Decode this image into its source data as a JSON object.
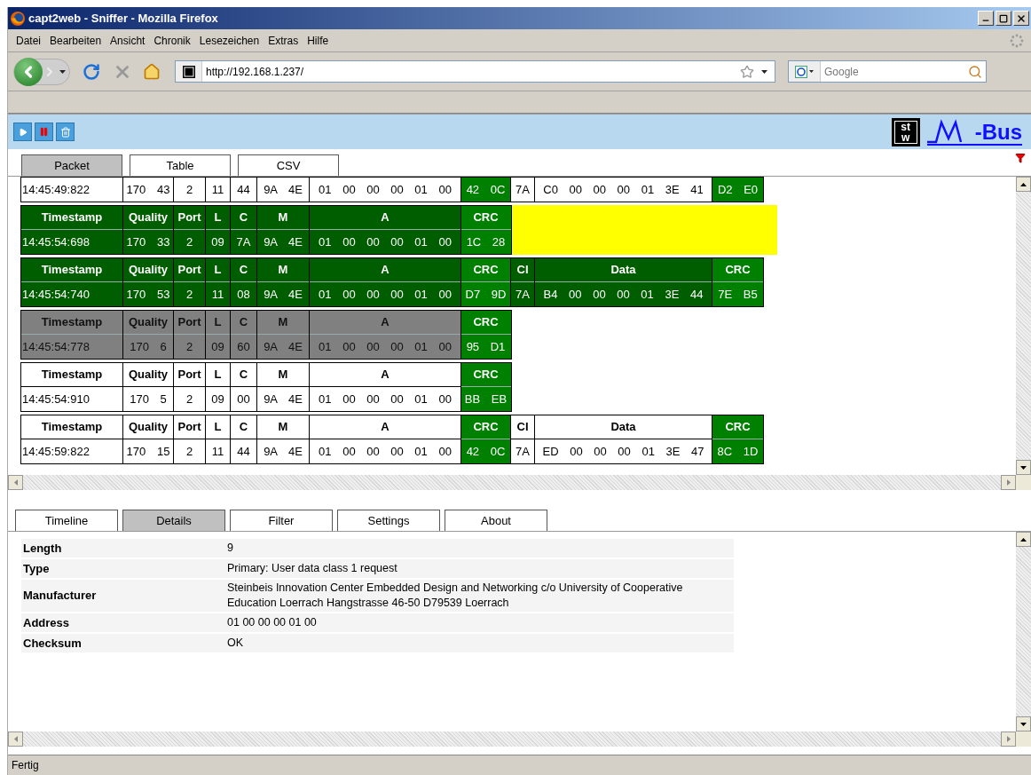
{
  "window": {
    "title": "capt2web - Sniffer - Mozilla Firefox"
  },
  "menu": [
    "Datei",
    "Bearbeiten",
    "Ansicht",
    "Chronik",
    "Lesezeichen",
    "Extras",
    "Hilfe"
  ],
  "address_bar": {
    "value": "http://192.168.1.237/"
  },
  "search": {
    "placeholder": "Google"
  },
  "toolbar": [
    {
      "kind": "play"
    },
    {
      "kind": "pause"
    },
    {
      "kind": "delete"
    }
  ],
  "logo": {
    "mark_lines": [
      "st",
      "w"
    ],
    "text": "-Bus"
  },
  "view_tabs": [
    {
      "label": "Packet",
      "selected": true
    },
    {
      "label": "Table",
      "selected": false
    },
    {
      "label": "CSV",
      "selected": false
    }
  ],
  "packets": [
    {
      "kind": "plain",
      "selected": false,
      "fields": [
        {
          "value": "14:45:49:822"
        },
        {
          "value": "170 43"
        },
        {
          "value": "2"
        },
        {
          "value": "11"
        },
        {
          "value": "44"
        },
        {
          "value": "9A 4E"
        },
        {
          "value": "01 00 00 00 01 00"
        },
        {
          "value": "42 0C",
          "kind": "crc"
        },
        {
          "value": "7A"
        },
        {
          "value": "C0 00 00 00 01 3E 41"
        },
        {
          "value": "D2 E0",
          "kind": "crc"
        }
      ]
    },
    {
      "kind": "ok",
      "selected": true,
      "fields": [
        {
          "label": "Timestamp",
          "value": "14:45:54:698"
        },
        {
          "label": "Quality",
          "value": "170 33"
        },
        {
          "label": "Port",
          "value": "2"
        },
        {
          "label": "L",
          "value": "09"
        },
        {
          "label": "C",
          "value": "7A"
        },
        {
          "label": "M",
          "value": "9A 4E"
        },
        {
          "label": "A",
          "value": "01 00 00 00 01 00"
        },
        {
          "label": "CRC",
          "value": "1C 28",
          "kind": "crc"
        }
      ]
    },
    {
      "kind": "ok",
      "selected": false,
      "fields": [
        {
          "label": "Timestamp",
          "value": "14:45:54:740"
        },
        {
          "label": "Quality",
          "value": "170 53"
        },
        {
          "label": "Port",
          "value": "2"
        },
        {
          "label": "L",
          "value": "11"
        },
        {
          "label": "C",
          "value": "08"
        },
        {
          "label": "M",
          "value": "9A 4E"
        },
        {
          "label": "A",
          "value": "01 00 00 00 01 00"
        },
        {
          "label": "CRC",
          "value": "D7 9D",
          "kind": "crc"
        },
        {
          "label": "CI",
          "value": "7A"
        },
        {
          "label": "Data",
          "value": "B4 00 00 00 01 3E 44"
        },
        {
          "label": "CRC",
          "value": "7E B5",
          "kind": "crc"
        }
      ]
    },
    {
      "kind": "error",
      "selected": false,
      "fields": [
        {
          "label": "Timestamp",
          "value": "14:45:54:778"
        },
        {
          "label": "Quality",
          "value": "170 6"
        },
        {
          "label": "Port",
          "value": "2"
        },
        {
          "label": "L",
          "value": "09"
        },
        {
          "label": "C",
          "value": "60"
        },
        {
          "label": "M",
          "value": "9A 4E"
        },
        {
          "label": "A",
          "value": "01 00 00 00 01 00"
        },
        {
          "label": "CRC",
          "value": "95 D1",
          "kind": "crc"
        }
      ]
    },
    {
      "kind": "plain",
      "selected": false,
      "fields": [
        {
          "label": "Timestamp",
          "value": "14:45:54:910"
        },
        {
          "label": "Quality",
          "value": "170 5"
        },
        {
          "label": "Port",
          "value": "2"
        },
        {
          "label": "L",
          "value": "09"
        },
        {
          "label": "C",
          "value": "00"
        },
        {
          "label": "M",
          "value": "9A 4E"
        },
        {
          "label": "A",
          "value": "01 00 00 00 01 00"
        },
        {
          "label": "CRC",
          "value": "BB EB",
          "kind": "crc"
        }
      ]
    },
    {
      "kind": "plain",
      "selected": false,
      "fields": [
        {
          "label": "Timestamp",
          "value": "14:45:59:822"
        },
        {
          "label": "Quality",
          "value": "170 15"
        },
        {
          "label": "Port",
          "value": "2"
        },
        {
          "label": "L",
          "value": "11"
        },
        {
          "label": "C",
          "value": "44"
        },
        {
          "label": "M",
          "value": "9A 4E"
        },
        {
          "label": "A",
          "value": "01 00 00 00 01 00"
        },
        {
          "label": "CRC",
          "value": "42 0C",
          "kind": "crc"
        },
        {
          "label": "CI",
          "value": "7A"
        },
        {
          "label": "Data",
          "value": "ED 00 00 00 01 3E 47"
        },
        {
          "label": "CRC",
          "value": "8C 1D",
          "kind": "crc"
        }
      ]
    }
  ],
  "detail_tabs": [
    {
      "label": "Timeline",
      "selected": false
    },
    {
      "label": "Details",
      "selected": true
    },
    {
      "label": "Filter",
      "selected": false
    },
    {
      "label": "Settings",
      "selected": false
    },
    {
      "label": "About",
      "selected": false
    }
  ],
  "details": [
    {
      "label": "Length",
      "value": "9"
    },
    {
      "label": "Type",
      "value": "Primary: User data class 1 request"
    },
    {
      "label": "Manufacturer",
      "value": "Steinbeis Innovation Center Embedded Design and Networking c/o University of Cooperative Education Loerrach Hangstrasse 46-50 D79539 Loerrach"
    },
    {
      "label": "Address",
      "value": "01 00 00 00 01 00"
    },
    {
      "label": "Checksum",
      "value": "OK"
    }
  ],
  "status_bar": "Fertig"
}
